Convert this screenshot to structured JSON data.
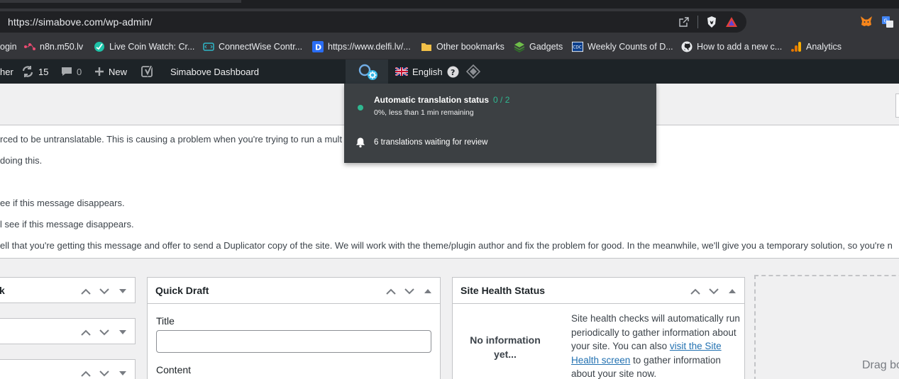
{
  "browser": {
    "url": "https://simabove.com/wp-admin/",
    "bookmarks": [
      {
        "label": "ogin",
        "icon": "generic-icon"
      },
      {
        "label": "n8n.m50.lv",
        "icon": "n8n-icon"
      },
      {
        "label": "Live Coin Watch: Cr...",
        "icon": "livecoinwatch-icon"
      },
      {
        "label": "ConnectWise Contr...",
        "icon": "connectwise-icon"
      },
      {
        "label": "https://www.delfi.lv/...",
        "icon": "delfi-icon"
      },
      {
        "label": "Other bookmarks",
        "icon": "folder-icon"
      },
      {
        "label": "Gadgets",
        "icon": "gadgets-icon"
      },
      {
        "label": "Weekly Counts of D...",
        "icon": "cdc-icon"
      },
      {
        "label": "How to add a new c...",
        "icon": "github-icon"
      },
      {
        "label": "Analytics",
        "icon": "analytics-icon"
      }
    ]
  },
  "adminbar": {
    "site_fragment": "her",
    "updates_count": "15",
    "comments_count": "0",
    "new_label": "New",
    "dashboard_label": "Simabove Dashboard",
    "language_label": "English"
  },
  "translation_dropdown": {
    "status_title": "Automatic translation status",
    "status_count": "0 / 2",
    "status_sub": "0%, less than 1 min remaining",
    "review_text": "6 translations waiting for review"
  },
  "notice": {
    "lines": [
      "rced to be untranslatable. This is causing a problem when you're trying to run a mult",
      "doing this.",
      "ee if this message disappears.",
      "l see if this message disappears.",
      "ell that you're getting this message and offer to send a Duplicator copy of the site. We will work with the theme/plugin author and fix the problem for good. In the meanwhile, we'll give you a temporary solution, so you're n"
    ]
  },
  "widgets": {
    "left_title": "k",
    "quick_draft": {
      "title": "Quick Draft",
      "title_label": "Title",
      "content_label": "Content"
    },
    "site_health": {
      "title": "Site Health Status",
      "empty_line1": "No information",
      "empty_line2": "yet...",
      "text_before": "Site health checks will automatically run periodically to gather information about your site. You can also ",
      "link_text": "visit the Site Health screen",
      "text_after": " to gather information about your site now."
    },
    "drag_label": "Drag bo"
  },
  "colors": {
    "adminbar_bg": "#1d2327",
    "dropdown_bg": "#3c4043",
    "status_green": "#2fb891",
    "link_blue": "#2271b1"
  }
}
